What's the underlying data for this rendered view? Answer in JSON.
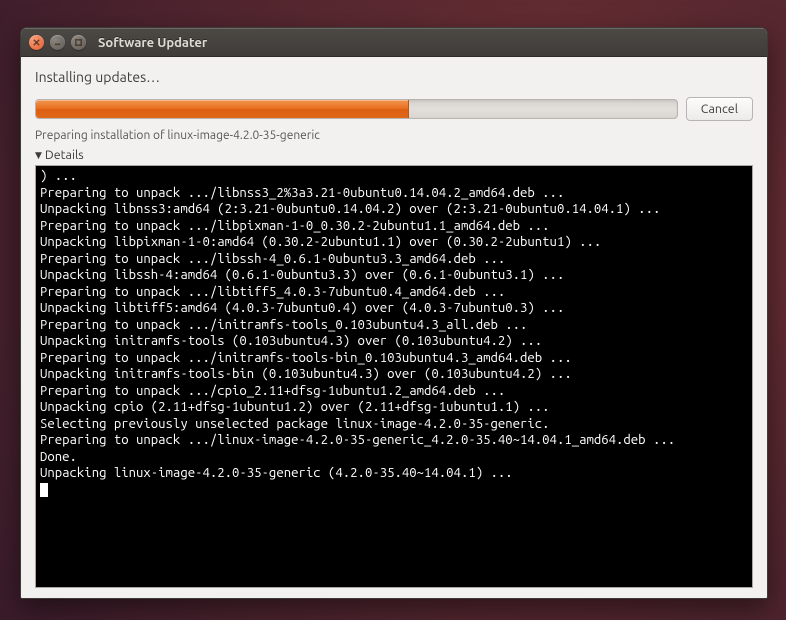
{
  "window": {
    "title": "Software Updater"
  },
  "status": "Installing updates…",
  "progress": {
    "percent": 58,
    "cancel_label": "Cancel"
  },
  "substatus": "Preparing installation of linux-image-4.2.0-35-generic",
  "details": {
    "label": "Details",
    "expanded": true
  },
  "terminal_lines": [
    ") ...",
    "Preparing to unpack .../libnss3_2%3a3.21-0ubuntu0.14.04.2_amd64.deb ...",
    "Unpacking libnss3:amd64 (2:3.21-0ubuntu0.14.04.2) over (2:3.21-0ubuntu0.14.04.1) ...",
    "Preparing to unpack .../libpixman-1-0_0.30.2-2ubuntu1.1_amd64.deb ...",
    "Unpacking libpixman-1-0:amd64 (0.30.2-2ubuntu1.1) over (0.30.2-2ubuntu1) ...",
    "Preparing to unpack .../libssh-4_0.6.1-0ubuntu3.3_amd64.deb ...",
    "Unpacking libssh-4:amd64 (0.6.1-0ubuntu3.3) over (0.6.1-0ubuntu3.1) ...",
    "Preparing to unpack .../libtiff5_4.0.3-7ubuntu0.4_amd64.deb ...",
    "Unpacking libtiff5:amd64 (4.0.3-7ubuntu0.4) over (4.0.3-7ubuntu0.3) ...",
    "Preparing to unpack .../initramfs-tools_0.103ubuntu4.3_all.deb ...",
    "Unpacking initramfs-tools (0.103ubuntu4.3) over (0.103ubuntu4.2) ...",
    "Preparing to unpack .../initramfs-tools-bin_0.103ubuntu4.3_amd64.deb ...",
    "Unpacking initramfs-tools-bin (0.103ubuntu4.3) over (0.103ubuntu4.2) ...",
    "Preparing to unpack .../cpio_2.11+dfsg-1ubuntu1.2_amd64.deb ...",
    "Unpacking cpio (2.11+dfsg-1ubuntu1.2) over (2.11+dfsg-1ubuntu1.1) ...",
    "Selecting previously unselected package linux-image-4.2.0-35-generic.",
    "Preparing to unpack .../linux-image-4.2.0-35-generic_4.2.0-35.40~14.04.1_amd64.deb ...",
    "Done.",
    "Unpacking linux-image-4.2.0-35-generic (4.2.0-35.40~14.04.1) ..."
  ]
}
